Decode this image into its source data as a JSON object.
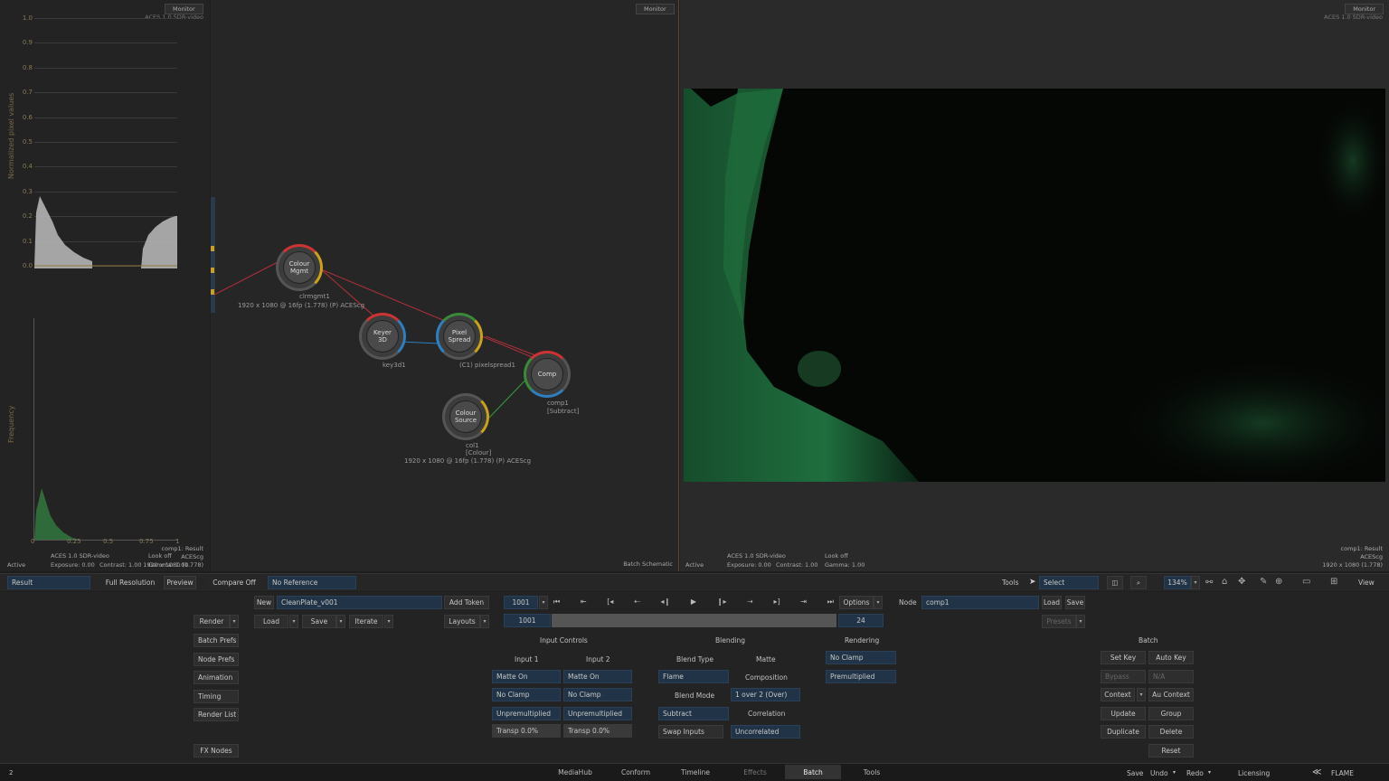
{
  "scopes": {
    "monitor_btn": "Monitor",
    "colorspace": "ACES 1.0 SDR-video",
    "waveform_ylabel": "Normalized pixel values",
    "waveform_ticks": [
      "1.0",
      "0.9",
      "0.8",
      "0.7",
      "0.6",
      "0.5",
      "0.4",
      "0.3",
      "0.2",
      "0.1",
      "0.0"
    ],
    "hist_ylabel": "Frequency",
    "hist_ticks": [
      "0",
      "0.25",
      "0.5",
      "0.75",
      "1"
    ],
    "footer": {
      "status": "Active",
      "cs": "ACES 1.0 SDR-video",
      "exposure": "Exposure: 0.00",
      "contrast": "Contrast: 1.00",
      "look": "Look off",
      "gamma": "Gamma: 1.00",
      "node": "comp1: Result",
      "cs2": "ACEScg",
      "res": "1920 x 1080 (1.778)"
    }
  },
  "schematic": {
    "monitor_btn": "Monitor",
    "footer": "Batch Schematic",
    "nodes": [
      {
        "title": "Colour\nMgmt",
        "label": "clrmgmt1",
        "info": "1920 x 1080 @ 16fp (1.778) (P) ACEScg"
      },
      {
        "title": "Keyer\n3D",
        "label": "key3d1"
      },
      {
        "title": "Pixel\nSpread",
        "label": "(C1) pixelspread1"
      },
      {
        "title": "Comp",
        "label": "comp1",
        "sub": "[Subtract]"
      },
      {
        "title": "Colour\nSource",
        "label": "col1",
        "sub": "[Colour]",
        "info": "1920 x 1080 @ 16fp (1.778) (P) ACEScg"
      }
    ]
  },
  "viewer": {
    "monitor_btn": "Monitor",
    "colorspace": "ACES 1.0 SDR-video",
    "footer": {
      "status": "Active",
      "cs": "ACES 1.0 SDR-video",
      "exposure": "Exposure: 0.00",
      "contrast": "Contrast: 1.00",
      "look": "Look off",
      "gamma": "Gamma: 1.00",
      "node": "comp1: Result",
      "cs2": "ACEScg",
      "res": "1920 x 1080 (1.778)"
    }
  },
  "viewbar": {
    "result": "Result",
    "full_res": "Full Resolution",
    "preview": "Preview",
    "compare": "Compare Off",
    "reference": "No Reference",
    "tools": "Tools",
    "select": "Select",
    "zoom": "134%",
    "view": "View"
  },
  "controls": {
    "new": "New",
    "setup_name": "CleanPlate_v001",
    "add_token": "Add Token",
    "frame": "1001",
    "frame_start": "1001",
    "frame_end": "24",
    "options": "Options",
    "node_label": "Node",
    "node_name": "comp1",
    "load": "Load",
    "save": "Save",
    "presets": "Presets",
    "render": "Render",
    "load2": "Load",
    "save2": "Save",
    "iterate": "Iterate",
    "layouts": "Layouts",
    "left_menu": [
      "Batch Prefs",
      "Node Prefs",
      "Animation",
      "Timing",
      "Render List"
    ],
    "fx_nodes": "FX Nodes",
    "input_controls": "Input Controls",
    "input1": "Input 1",
    "input2": "Input 2",
    "matte_on1": "Matte On",
    "matte_on2": "Matte On",
    "no_clamp1": "No Clamp",
    "no_clamp2": "No Clamp",
    "unpremult1": "Unpremultiplied",
    "unpremult2": "Unpremultiplied",
    "transp1": "Transp 0.0%",
    "transp2": "Transp 0.0%",
    "blending": "Blending",
    "blend_type": "Blend Type",
    "matte": "Matte",
    "flame": "Flame",
    "composition": "Composition",
    "blend_mode": "Blend Mode",
    "over": "1 over 2 (Over)",
    "subtract": "Subtract",
    "correlation": "Correlation",
    "swap": "Swap Inputs",
    "uncorrelated": "Uncorrelated",
    "rendering": "Rendering",
    "r_noclamp": "No Clamp",
    "r_premult": "Premultiplied",
    "batch": "Batch",
    "set_key": "Set Key",
    "auto_key": "Auto Key",
    "bypass": "Bypass",
    "na": "N/A",
    "context": "Context",
    "au_context": "Au Context",
    "update": "Update",
    "group": "Group",
    "duplicate": "Duplicate",
    "delete": "Delete",
    "reset": "Reset"
  },
  "tabs": [
    "MediaHub",
    "Conform",
    "Timeline",
    "Effects",
    "Batch",
    "Tools"
  ],
  "bottom": {
    "left": "2",
    "save": "Save",
    "undo": "Undo",
    "redo": "Redo",
    "licensing": "Licensing",
    "app": "FLAME"
  }
}
